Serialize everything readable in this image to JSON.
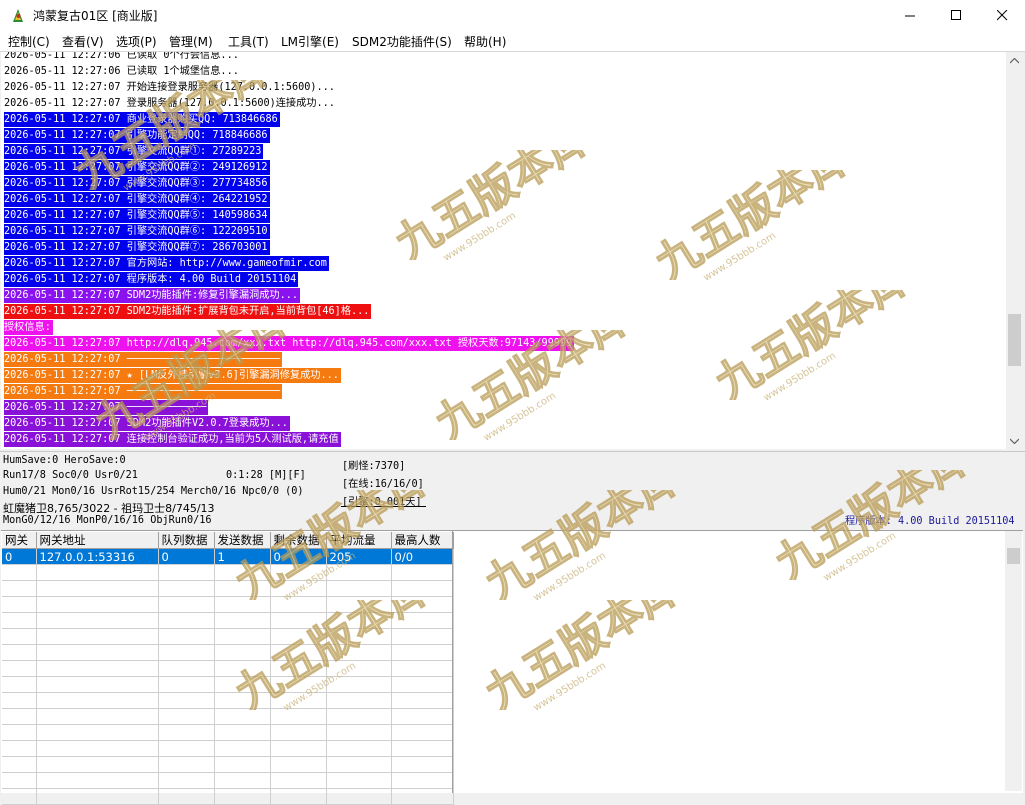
{
  "window": {
    "title": "鸿蒙复古01区 [商业版]",
    "minimize_icon": "minimize-icon",
    "maximize_icon": "maximize-icon",
    "close_icon": "close-icon"
  },
  "menu": [
    "控制(C)",
    "查看(V)",
    "选项(P)",
    "管理(M)",
    "工具(T)",
    "LM引擎(E)",
    "SDM2功能插件(S)",
    "帮助(H)"
  ],
  "log": [
    {
      "text": "2026-05-11 12:27:06 已读取 0个行会信息...",
      "fg": "#000000",
      "bg": "#ffffff"
    },
    {
      "text": "2026-05-11 12:27:06 已读取 1个城堡信息...",
      "fg": "#000000",
      "bg": "#ffffff"
    },
    {
      "text": "2026-05-11 12:27:07 开始连接登录服务器(127.0.0.1:5600)...",
      "fg": "#000000",
      "bg": "#ffffff"
    },
    {
      "text": "2026-05-11 12:27:07 登录服务器(127.0.0.1:5600)连接成功...",
      "fg": "#000000",
      "bg": "#ffffff"
    },
    {
      "text": "2026-05-11 12:27:07 商业登录器购买QQ: 713846686",
      "fg": "#ffffff",
      "bg": "#0000ee"
    },
    {
      "text": "2026-05-11 12:27:07 引擎功能定制QQ: 718846686",
      "fg": "#ffffff",
      "bg": "#0000ee"
    },
    {
      "text": "2026-05-11 12:27:07 引擎交流QQ群①: 27289223",
      "fg": "#ffffff",
      "bg": "#0000ee"
    },
    {
      "text": "2026-05-11 12:27:07 引擎交流QQ群②: 249126912",
      "fg": "#ffffff",
      "bg": "#0000ee"
    },
    {
      "text": "2026-05-11 12:27:07 引擎交流QQ群③: 277734856",
      "fg": "#ffffff",
      "bg": "#0000ee"
    },
    {
      "text": "2026-05-11 12:27:07 引擎交流QQ群④: 264221952",
      "fg": "#ffffff",
      "bg": "#0000ee"
    },
    {
      "text": "2026-05-11 12:27:07 引擎交流QQ群⑤: 140598634",
      "fg": "#ffffff",
      "bg": "#0000ee"
    },
    {
      "text": "2026-05-11 12:27:07 引擎交流QQ群⑥: 122209510",
      "fg": "#ffffff",
      "bg": "#0000ee"
    },
    {
      "text": "2026-05-11 12:27:07 引擎交流QQ群⑦: 286703001",
      "fg": "#ffffff",
      "bg": "#0000ee"
    },
    {
      "text": "2026-05-11 12:27:07 官方网站: http://www.gameofmir.com",
      "fg": "#ffffff",
      "bg": "#0000ee"
    },
    {
      "text": "2026-05-11 12:27:07 程序版本: 4.00 Build 20151104",
      "fg": "#ffffff",
      "bg": "#0000ee"
    },
    {
      "text": "2026-05-11 12:27:07 SDM2功能插件:修复引擎漏洞成功...",
      "fg": "#ffffff",
      "bg": "#8a12f0"
    },
    {
      "text": "2026-05-11 12:27:07 SDM2功能插件:扩展背包未开启,当前背包[46]格...",
      "fg": "#ffffff",
      "bg": "#ee1010"
    },
    {
      "text": "授权信息:",
      "fg": "#ffffff",
      "bg": "#ee12ee"
    },
    {
      "text": "2026-05-11 12:27:07 http://dlq.945.com/xxx.txt http://dlq.945.com/xxx.txt 授权天数:97143/99999",
      "fg": "#ffffff",
      "bg": "#ee12ee"
    },
    {
      "text": "2026-05-11 12:27:07 ─────────────────────────",
      "fg": "#ffffff",
      "bg": "#f57a10"
    },
    {
      "text": "2026-05-11 12:27:07 ★ [LM反外挂引擎v3.6]引擎漏洞修复成功...",
      "fg": "#ffffff",
      "bg": "#f57a10"
    },
    {
      "text": "2026-05-11 12:27:07 ─────────────────────────",
      "fg": "#ffffff",
      "bg": "#f57a10"
    },
    {
      "text": "2026-05-11 12:27:07 ─────────────",
      "fg": "#ffffff",
      "bg": "#8a12d8"
    },
    {
      "text": "2026-05-11 12:27:07 SDM2功能插件V2.0.7登录成功...",
      "fg": "#ffffff",
      "bg": "#8a12d8"
    },
    {
      "text": "2026-05-11 12:27:07 连接控制台验证成功,当前为5人测试版,请充值",
      "fg": "#ffffff",
      "bg": "#8a12d8"
    }
  ],
  "status": {
    "hero_save": "HumSave:0 HeroSave:0",
    "run_line": "Run17/8 Soc0/0 Usr0/21",
    "time_line": "0:1:28 [M][F]",
    "hum_line": "Hum0/21 Mon0/16 UsrRot15/254 Merch0/16 Npc0/0 (0)",
    "monster_line": "虹魔猪卫8,765/3022 - 祖玛卫士8/745/13",
    "mon_line": "MonG0/12/16 MonP0/16/16 ObjRun0/16",
    "refresh": "[刷怪:7370]",
    "online": "[在线:16/16/0]",
    "engine": "[引擎:0.001天]",
    "version": "程序版本: 4.00 Build 20151104"
  },
  "grid": {
    "columns": [
      "网关",
      "网关地址",
      "队列数据",
      "发送数据",
      "剩余数据",
      "平均流量",
      "最高人数"
    ],
    "rows": [
      [
        "0",
        "127.0.0.1:53316",
        "0",
        "1",
        "0",
        "205",
        "0/0"
      ]
    ],
    "empty_rows": 15
  },
  "watermark": {
    "text": "九五版本库",
    "sub": "www.95bbb.com"
  }
}
